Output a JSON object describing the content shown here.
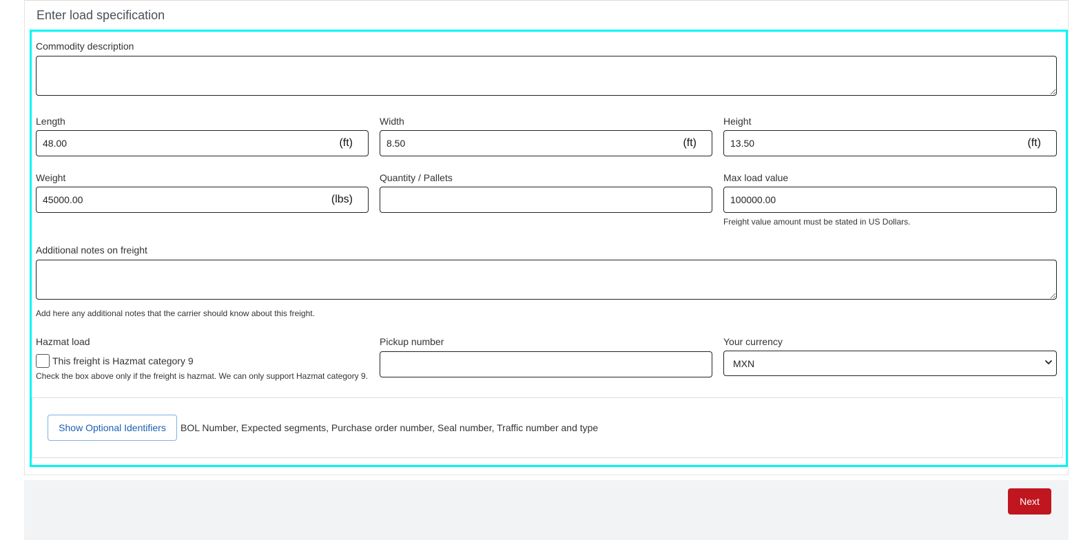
{
  "section": {
    "title": "Enter load specification"
  },
  "commodity": {
    "label": "Commodity description",
    "value": ""
  },
  "length": {
    "label": "Length",
    "value": "48.00",
    "unit": "(ft)"
  },
  "width": {
    "label": "Width",
    "value": "8.50",
    "unit": "(ft)"
  },
  "height": {
    "label": "Height",
    "value": "13.50",
    "unit": "(ft)"
  },
  "weight": {
    "label": "Weight",
    "value": "45000.00",
    "unit": "(lbs)"
  },
  "quantity": {
    "label": "Quantity / Pallets",
    "value": ""
  },
  "max_value": {
    "label": "Max load value",
    "value": "100000.00",
    "help": "Freight value amount must be stated in US Dollars."
  },
  "notes": {
    "label": "Additional notes on freight",
    "value": "",
    "help": "Add here any additional notes that the carrier should know about this freight."
  },
  "hazmat": {
    "label": "Hazmat load",
    "checkbox_label": "This freight is Hazmat category 9",
    "checked": false,
    "help": "Check the box above only if the freight is hazmat. We can only support Hazmat category 9."
  },
  "pickup": {
    "label": "Pickup number",
    "value": ""
  },
  "currency": {
    "label": "Your currency",
    "selected": "MXN"
  },
  "optional": {
    "button_label": "Show Optional Identifiers",
    "description": "BOL Number, Expected segments, Purchase order number, Seal number, Traffic number and type"
  },
  "footer": {
    "next_label": "Next"
  },
  "colors": {
    "accent_highlight": "#00f5f5",
    "primary_button": "#c0161f",
    "link_blue": "#1a5fb4"
  }
}
